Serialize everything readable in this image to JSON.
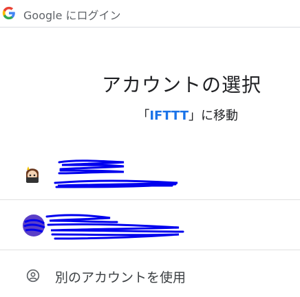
{
  "header": {
    "title": "Google にログイン"
  },
  "main": {
    "title": "アカウントの選択",
    "subtitle_prefix": "「",
    "app_name": "IFTTT",
    "subtitle_suffix": "」に移動"
  },
  "accounts": [
    {
      "redacted": true
    },
    {
      "redacted": true
    }
  ],
  "use_another_account": {
    "label": "別のアカウントを使用"
  },
  "colors": {
    "accent": "#1a73e8",
    "redaction": "#0000ee",
    "avatar2": "#5b3fc7"
  }
}
